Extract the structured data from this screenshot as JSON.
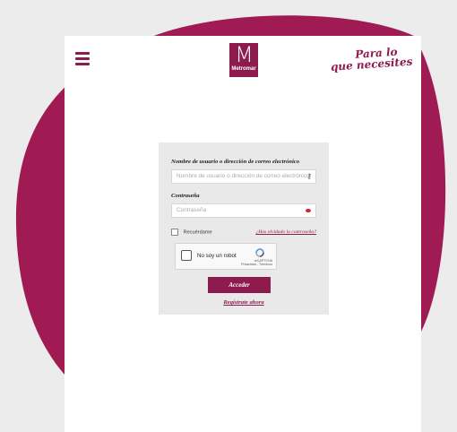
{
  "colors": {
    "brand": "#8e1b4e",
    "background": "#ececec",
    "form_panel": "#e9e9e9"
  },
  "header": {
    "logo_text": "Metromar",
    "slogan_line1": "Para lo",
    "slogan_line2": "que necesites"
  },
  "form": {
    "username_label": "Nombre de usuario o dirección de correo electrónico",
    "username_placeholder": "Nombre de usuario o dirección de correo electrónico",
    "password_label": "Contraseña",
    "password_placeholder": "Contraseña",
    "remember_label": "Recuérdame",
    "forgot_link": "¿Has olvidado la contraseña?",
    "captcha_label": "No soy un robot",
    "captcha_brand": "reCAPTCHA",
    "captcha_links": "Privacidad - Términos",
    "submit_label": "Acceder",
    "register_link": "Regístrate ahora"
  }
}
